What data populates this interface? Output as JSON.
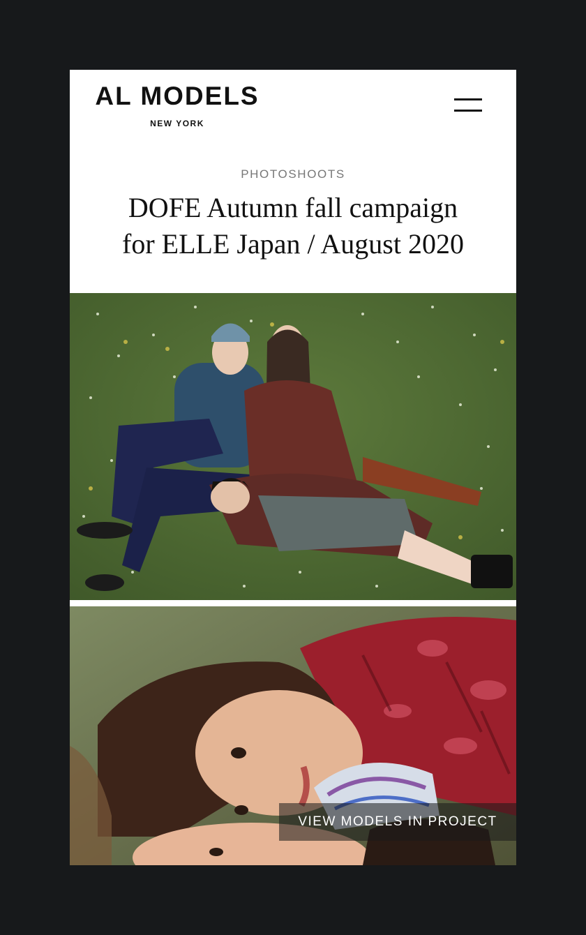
{
  "brand": {
    "name": "AL MODELS",
    "location": "NEW YORK"
  },
  "header": {
    "menu_icon": "hamburger-menu-icon"
  },
  "article": {
    "category": "PHOTOSHOOTS",
    "title_line1": "DOFE Autumn fall campaign",
    "title_line2": "for ELLE  Japan / August 2020"
  },
  "cta": {
    "label": "VIEW MODELS IN PROJECT"
  },
  "colors": {
    "page_background": "#17191b",
    "card_background": "#ffffff",
    "text": "#111111",
    "category_text": "#777777"
  }
}
